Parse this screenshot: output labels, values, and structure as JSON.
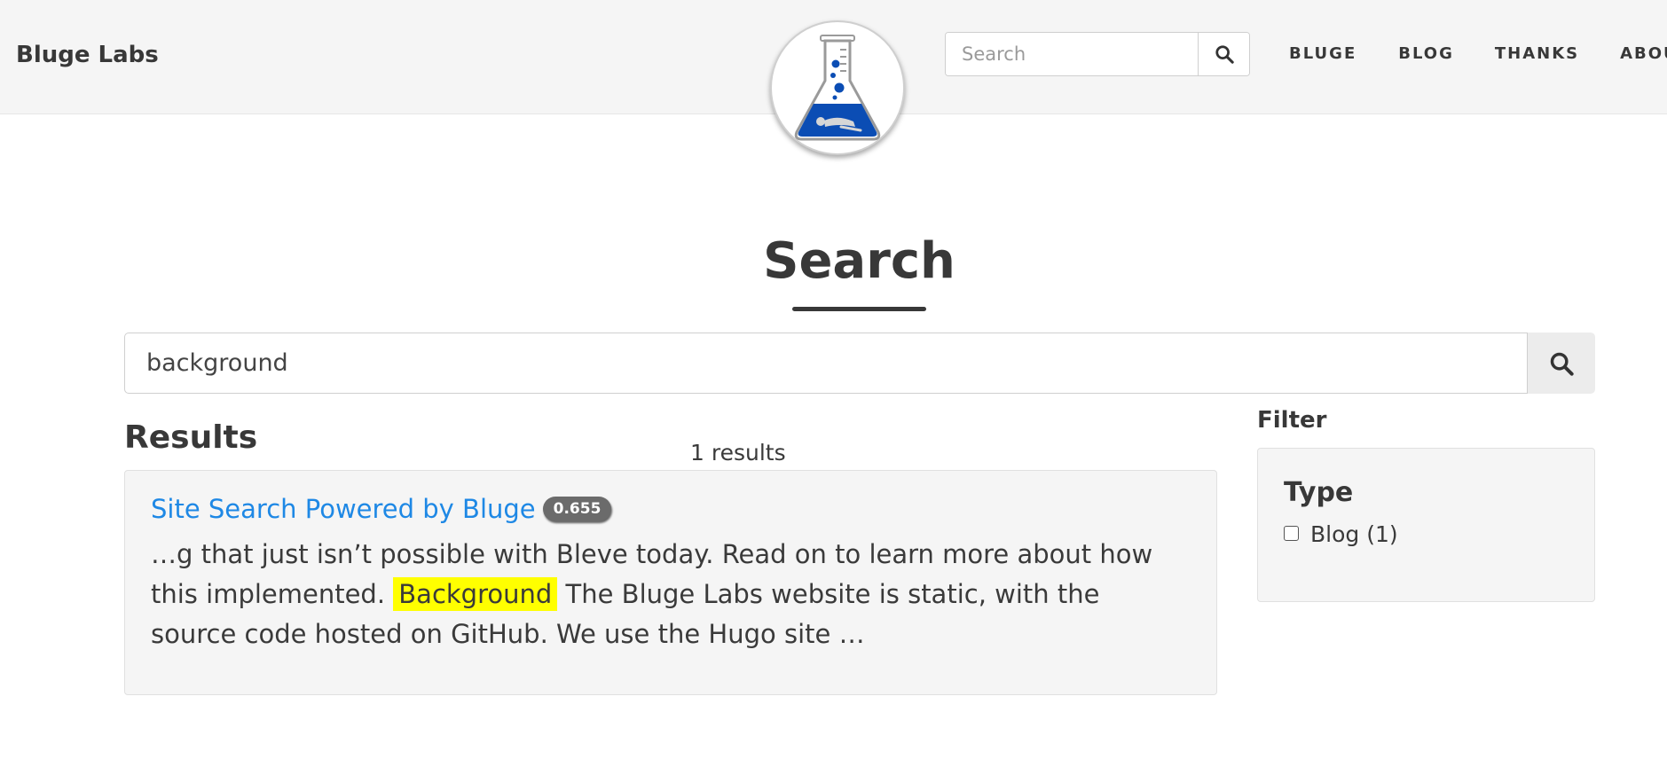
{
  "header": {
    "brand": "Bluge Labs",
    "logo_icon": "flask-logo-icon",
    "search": {
      "placeholder": "Search",
      "value": "",
      "icon": "search-icon"
    },
    "nav": [
      {
        "label": "BLUGE"
      },
      {
        "label": "BLOG"
      },
      {
        "label": "THANKS"
      },
      {
        "label": "ABOUT"
      }
    ]
  },
  "main": {
    "title": "Search",
    "search": {
      "value": "background",
      "icon": "search-icon"
    },
    "results_heading": "Results",
    "results_count": "1 results",
    "results": [
      {
        "title": "Site Search Powered by Bluge",
        "score": "0.655",
        "snippet_before": "…g that just isn’t possible with Bleve today. Read on to learn more about how this implemented.",
        "snippet_highlight": "Background",
        "snippet_after": "The Bluge Labs website is static, with the source code hosted on GitHub. We use the Hugo site …"
      }
    ]
  },
  "filter": {
    "heading": "Filter",
    "type_heading": "Type",
    "options": [
      {
        "label": "Blog (1)",
        "checked": false
      }
    ]
  },
  "colors": {
    "header_bg": "#f5f5f5",
    "link": "#1e88e5",
    "highlight": "#ffff00",
    "badge": "#6b6b6b",
    "flask_blue": "#0b4db4"
  }
}
